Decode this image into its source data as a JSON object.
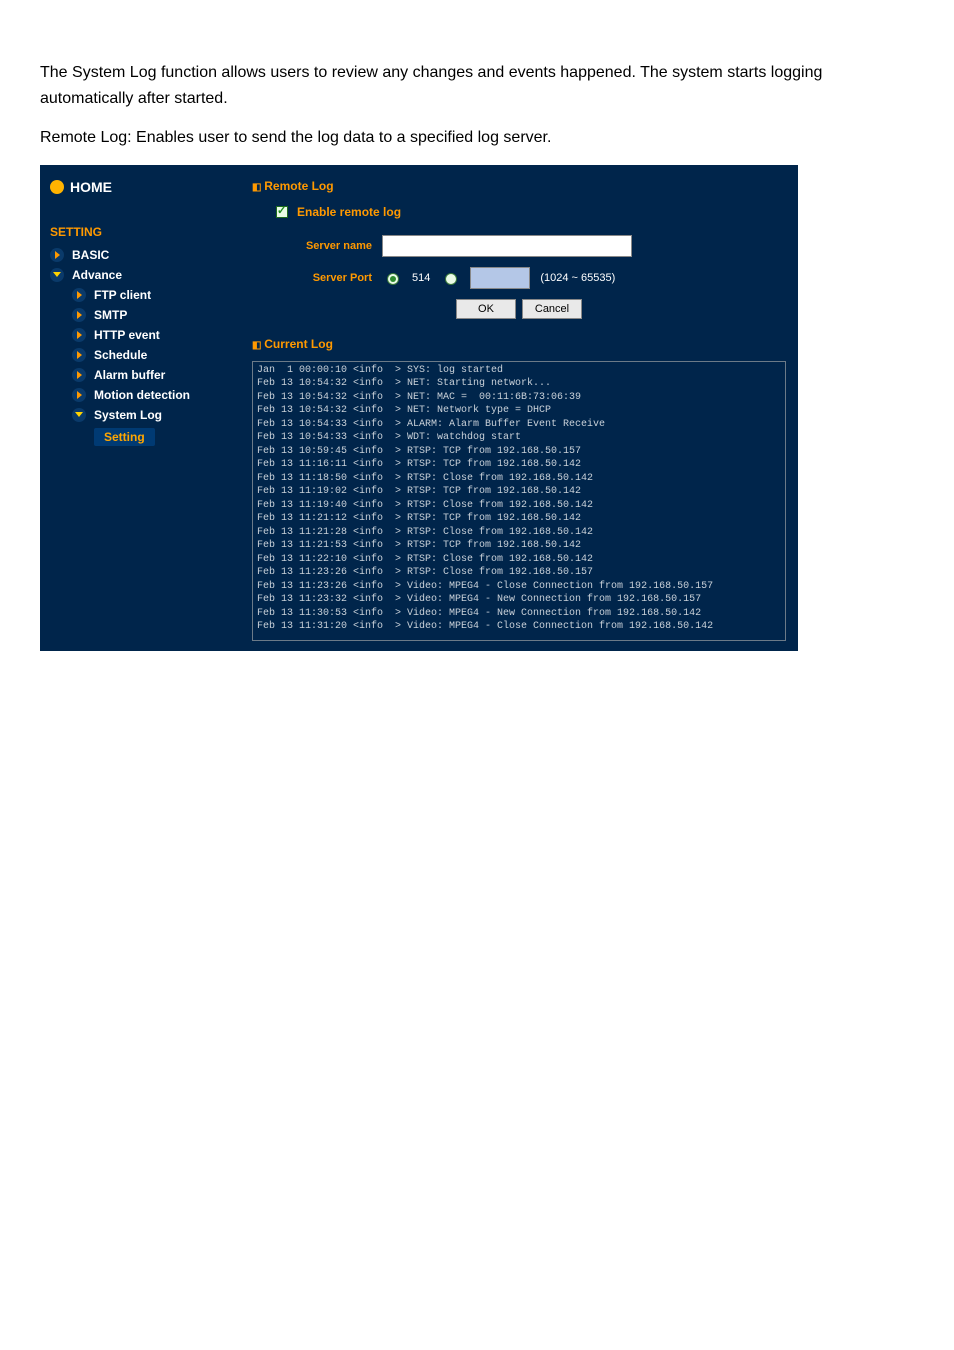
{
  "intro": {
    "p1": "The System Log function allows users to review any changes and events happened. The system starts logging automatically after started.",
    "p2": "Remote Log: Enables user to send the log data to a specified log server."
  },
  "sidebar": {
    "home": "HOME",
    "section": "SETTING",
    "items": [
      {
        "label": "BASIC",
        "level": 1,
        "arrow": "right"
      },
      {
        "label": "Advance",
        "level": 1,
        "arrow": "down"
      },
      {
        "label": "FTP client",
        "level": 2,
        "arrow": "right"
      },
      {
        "label": "SMTP",
        "level": 2,
        "arrow": "right"
      },
      {
        "label": "HTTP event",
        "level": 2,
        "arrow": "right"
      },
      {
        "label": "Schedule",
        "level": 2,
        "arrow": "right"
      },
      {
        "label": "Alarm buffer",
        "level": 2,
        "arrow": "right"
      },
      {
        "label": "Motion detection",
        "level": 2,
        "arrow": "right"
      },
      {
        "label": "System Log",
        "level": 2,
        "arrow": "down"
      },
      {
        "label": "Setting",
        "level": 3,
        "arrow": "none"
      }
    ]
  },
  "remoteLog": {
    "heading": "Remote Log",
    "enableLabel": "Enable remote log",
    "enableChecked": true,
    "serverNameLabel": "Server name",
    "serverNameValue": "",
    "serverPortLabel": "Server Port",
    "portOption514": "514",
    "portOptionCustom": "",
    "portSelected": "514",
    "portRangeNote": "(1024 ~ 65535)",
    "okLabel": "OK",
    "cancelLabel": "Cancel"
  },
  "currentLog": {
    "heading": "Current Log",
    "lines": [
      "Jan  1 00:00:10 <info  > SYS: log started",
      "Feb 13 10:54:32 <info  > NET: Starting network...",
      "Feb 13 10:54:32 <info  > NET: MAC =  00:11:6B:73:06:39",
      "Feb 13 10:54:32 <info  > NET: Network type = DHCP",
      "Feb 13 10:54:33 <info  > ALARM: Alarm Buffer Event Receive",
      "Feb 13 10:54:33 <info  > WDT: watchdog start",
      "Feb 13 10:59:45 <info  > RTSP: TCP from 192.168.50.157",
      "Feb 13 11:16:11 <info  > RTSP: TCP from 192.168.50.142",
      "Feb 13 11:18:50 <info  > RTSP: Close from 192.168.50.142",
      "Feb 13 11:19:02 <info  > RTSP: TCP from 192.168.50.142",
      "Feb 13 11:19:40 <info  > RTSP: Close from 192.168.50.142",
      "Feb 13 11:21:12 <info  > RTSP: TCP from 192.168.50.142",
      "Feb 13 11:21:28 <info  > RTSP: Close from 192.168.50.142",
      "Feb 13 11:21:53 <info  > RTSP: TCP from 192.168.50.142",
      "Feb 13 11:22:10 <info  > RTSP: Close from 192.168.50.142",
      "Feb 13 11:23:26 <info  > RTSP: Close from 192.168.50.157",
      "Feb 13 11:23:26 <info  > Video: MPEG4 - Close Connection from 192.168.50.157",
      "Feb 13 11:23:32 <info  > Video: MPEG4 - New Connection from 192.168.50.157",
      "Feb 13 11:30:53 <info  > Video: MPEG4 - New Connection from 192.168.50.142",
      "Feb 13 11:31:20 <info  > Video: MPEG4 - Close Connection from 192.168.50.142"
    ]
  }
}
